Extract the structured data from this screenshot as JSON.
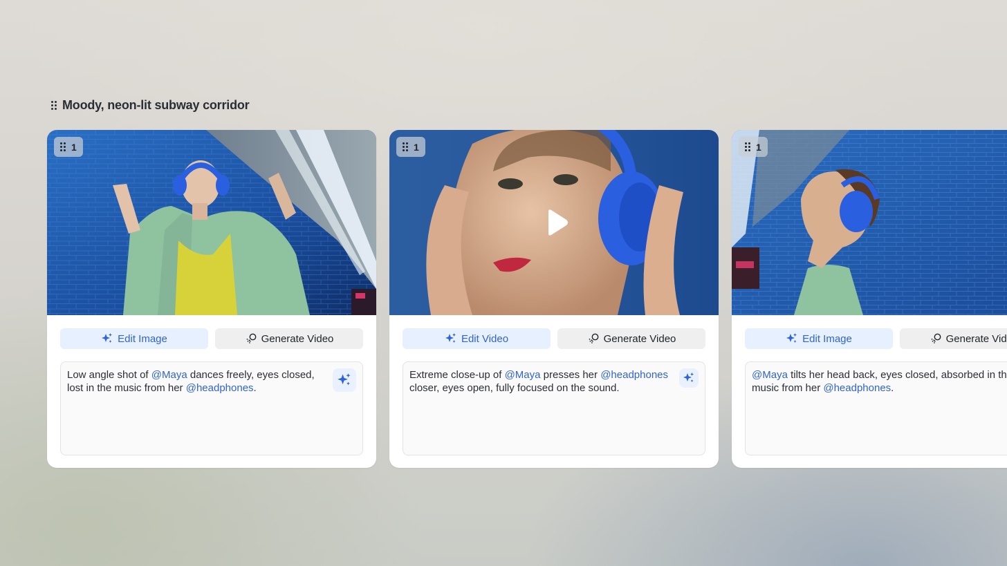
{
  "group": {
    "title": "Moody, neon-lit subway corridor"
  },
  "cards": [
    {
      "badge_count": "1",
      "media_kind": "image",
      "primary_action": "Edit Image",
      "secondary_action": "Generate Video",
      "prompt": {
        "p1": "Low angle shot of ",
        "m1": "@Maya",
        "p2": " dances freely, eyes closed, lost in the music from her ",
        "m2": "@headphones",
        "p3": "."
      }
    },
    {
      "badge_count": "1",
      "media_kind": "video",
      "primary_action": "Edit Video",
      "secondary_action": "Generate Video",
      "prompt": {
        "p1": "Extreme close-up of ",
        "m1": "@Maya",
        "p2": " presses her ",
        "m2": "@headphones",
        "p3": " closer, eyes open, fully focused on the sound."
      }
    },
    {
      "badge_count": "1",
      "media_kind": "image",
      "primary_action": "Edit Image",
      "secondary_action": "Generate Video",
      "prompt": {
        "p1": "",
        "m1": "@Maya",
        "p2": " tilts her head back, eyes closed, absorbed in the music from her ",
        "m2": "@headphones",
        "p3": "."
      }
    }
  ],
  "icons": {
    "drag_handle": "grip-dots-icon",
    "edit": "sparkles-icon",
    "generate_video": "video-generate-icon",
    "play": "play-icon",
    "enhance_prompt": "sparkles-icon"
  },
  "colors": {
    "accent": "#2f63d8",
    "accent_soft": "#e7f0fe",
    "card_bg": "#ffffff",
    "secondary_btn_bg": "#efefef",
    "tile_blue": "#1f55a8",
    "headphones_blue": "#2a5fe0",
    "jacket_green": "#8fc3a0",
    "top_yellow": "#d7d23a"
  }
}
